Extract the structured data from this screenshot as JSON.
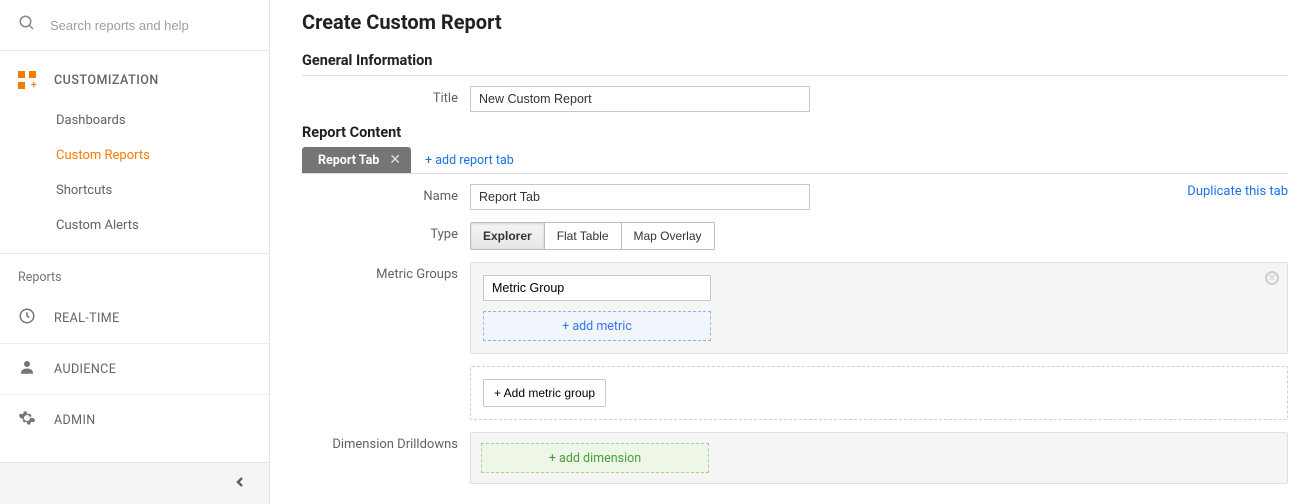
{
  "search": {
    "placeholder": "Search reports and help"
  },
  "sidebar": {
    "customization_label": "CUSTOMIZATION",
    "items": [
      {
        "label": "Dashboards"
      },
      {
        "label": "Custom Reports"
      },
      {
        "label": "Shortcuts"
      },
      {
        "label": "Custom Alerts"
      }
    ],
    "reports_label": "Reports",
    "realtime_label": "REAL-TIME",
    "audience_label": "AUDIENCE",
    "admin_label": "ADMIN"
  },
  "main": {
    "page_title": "Create Custom Report",
    "general": {
      "heading": "General Information",
      "title_label": "Title",
      "title_value": "New Custom Report"
    },
    "content": {
      "heading": "Report Content",
      "tab_label": "Report Tab",
      "add_tab_label": "+ add report tab",
      "duplicate_label": "Duplicate this tab",
      "name_label": "Name",
      "name_value": "Report Tab",
      "type_label": "Type",
      "type_options": {
        "explorer": "Explorer",
        "flat": "Flat Table",
        "map": "Map Overlay"
      },
      "metric_groups_label": "Metric Groups",
      "metric_group_value": "Metric Group",
      "add_metric_label": "+ add metric",
      "add_metric_group_label": "+ Add metric group",
      "dimension_label": "Dimension Drilldowns",
      "add_dimension_label": "+ add dimension"
    }
  }
}
